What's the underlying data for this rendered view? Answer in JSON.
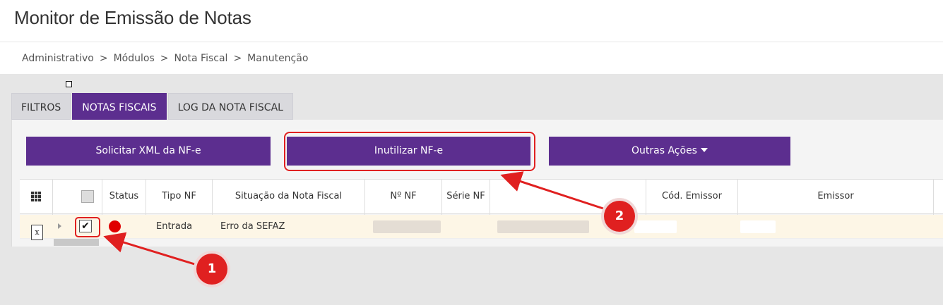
{
  "header": {
    "title": "Monitor de Emissão de Notas"
  },
  "breadcrumb": [
    {
      "label": "Administrativo"
    },
    {
      "label": "Módulos"
    },
    {
      "label": "Nota Fiscal"
    },
    {
      "label": "Manutenção"
    }
  ],
  "breadcrumb_separator": ">",
  "tabs": [
    {
      "label": "FILTROS",
      "active": false
    },
    {
      "label": "NOTAS FISCAIS",
      "active": true
    },
    {
      "label": "LOG DA NOTA FISCAL",
      "active": false
    }
  ],
  "actions": {
    "solicitar": "Solicitar XML da NF-e",
    "inutilizar": "Inutilizar NF-e",
    "outras": "Outras Ações"
  },
  "grid": {
    "columns": [
      "Status",
      "Tipo NF",
      "Situação da Nota Fiscal",
      "Nº NF",
      "Série NF",
      "Cód. Emissor",
      "Emissor"
    ],
    "row": {
      "tipo": "Entrada",
      "situacao": "Erro da SEFAZ",
      "checked": true,
      "status_color": "#e00000"
    }
  },
  "annotations": {
    "step1": "1",
    "step2": "2",
    "color": "#e02020"
  },
  "icons": {
    "grid": "grid-icon",
    "excel": "excel-export-icon",
    "caret": "caret-down-icon",
    "check": "check-icon"
  },
  "colors": {
    "brand": "#5c2e8f",
    "row_highlight": "#fdf6e6"
  }
}
